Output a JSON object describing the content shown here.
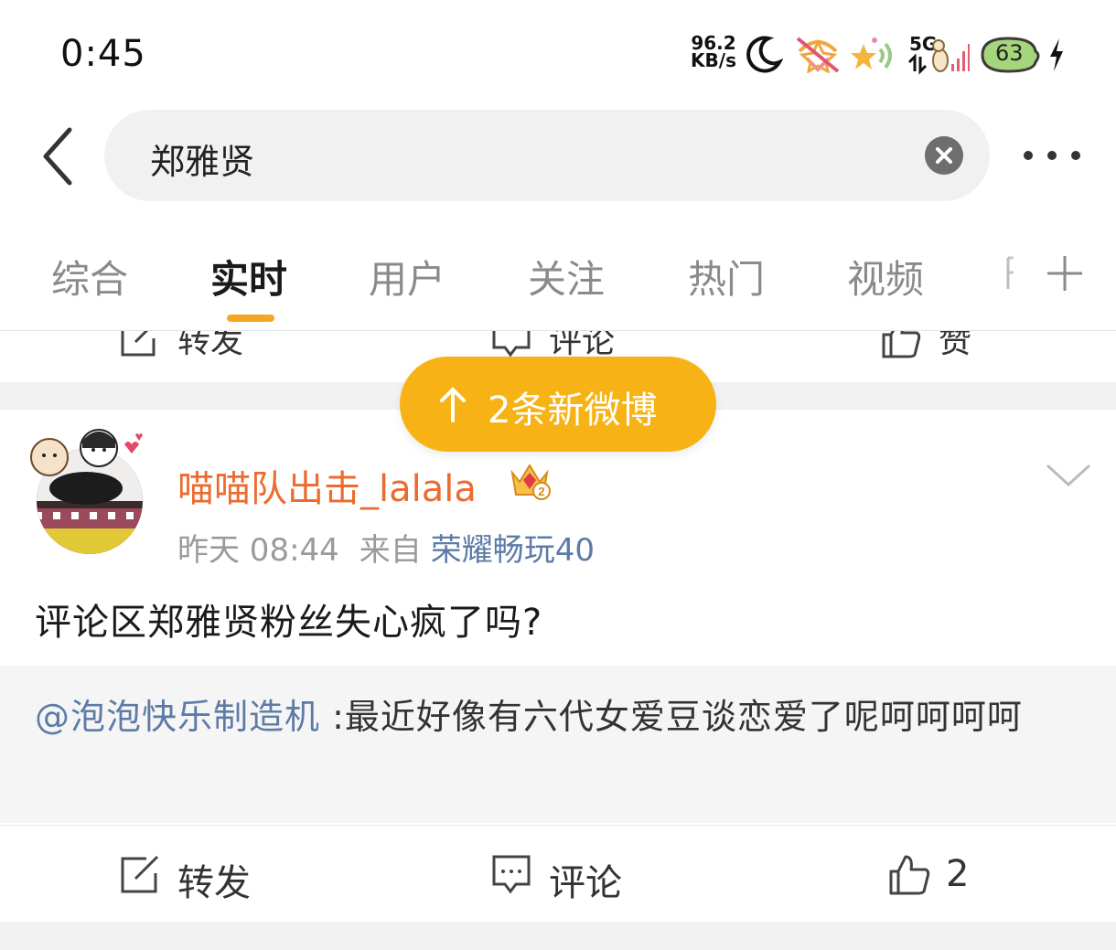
{
  "status_bar": {
    "time": "0:45",
    "net_speed_value": "96.2",
    "net_speed_unit": "KB/s",
    "signal_label": "5G",
    "battery_level": "63",
    "icons": [
      "moon-icon",
      "notification-off-icon",
      "wifi-icon",
      "signal-icon",
      "battery-icon",
      "charging-icon"
    ]
  },
  "search": {
    "query": "郑雅贤"
  },
  "tabs": [
    {
      "label": "综合",
      "active": false
    },
    {
      "label": "实时",
      "active": true
    },
    {
      "label": "用户",
      "active": false
    },
    {
      "label": "关注",
      "active": false
    },
    {
      "label": "热门",
      "active": false
    },
    {
      "label": "视频",
      "active": false
    }
  ],
  "prev_actions": {
    "repost": "转发",
    "comment": "评论",
    "like": "赞"
  },
  "new_posts_pill": "2条新微博",
  "post": {
    "user_name": "喵喵队出击_lalala",
    "vip_level": "2",
    "time": "昨天 08:44",
    "from_label": "来自",
    "source": "荣耀畅玩40",
    "text": "评论区郑雅贤粉丝失心疯了吗?",
    "repost": {
      "user": "@泡泡快乐制造机",
      "text": " :最近好像有六代女爱豆谈恋爱了呢呵呵呵呵"
    },
    "actions": {
      "repost": "转发",
      "comment": "评论",
      "like_count": "2"
    }
  },
  "colors": {
    "accent": "#f7b316",
    "username": "#ec6b2e",
    "link": "#5d7ba6"
  }
}
